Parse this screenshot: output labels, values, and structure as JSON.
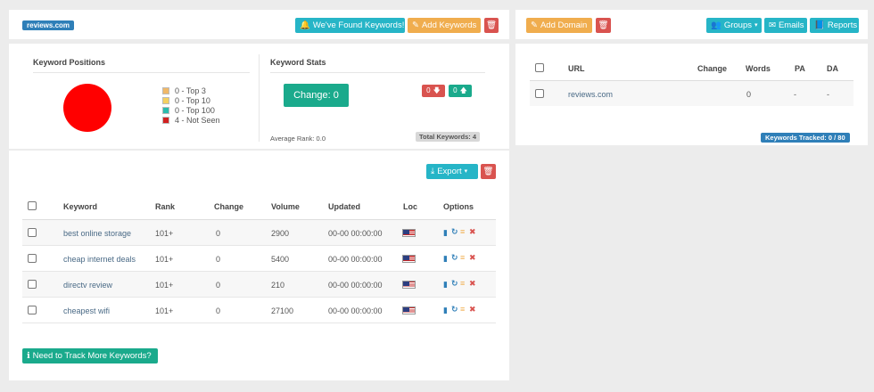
{
  "colors": {
    "teal": "#26b5c7",
    "orange": "#f0ad4e",
    "red": "#d9534f",
    "green": "#1aaa8c",
    "badge_blue": "#2f7fb8",
    "pie_red": "#ff0000"
  },
  "domain_badge": "reviews.com",
  "toolbar": {
    "found_keywords_label": "We've Found Keywords!",
    "found_keywords_icon": "bell-icon",
    "add_keywords_label": "Add Keywords",
    "add_keywords_icon": "edit-icon",
    "delete_icon": "trash-icon"
  },
  "keyword_positions": {
    "title": "Keyword Positions",
    "legend": [
      {
        "label": "0 - Top 3",
        "color": "#f0b868"
      },
      {
        "label": "0 - Top 10",
        "color": "#f5d060"
      },
      {
        "label": "0 - Top 100",
        "color": "#2bbbad"
      },
      {
        "label": "4 - Not Seen",
        "color": "#d12020"
      }
    ]
  },
  "keyword_stats": {
    "title": "Keyword Stats",
    "change_label": "Change: 0",
    "down_count": "0",
    "up_count": "0",
    "average_rank": "Average Rank: 0.0",
    "total_keywords": "Total Keywords: 4"
  },
  "keywords_table": {
    "export_label": "Export",
    "columns": [
      "Keyword",
      "Rank",
      "Change",
      "Volume",
      "Updated",
      "Loc",
      "Options"
    ],
    "rows": [
      {
        "keyword": "best online storage",
        "rank": "101+",
        "change": "0",
        "volume": "2900",
        "updated": "00-00 00:00:00"
      },
      {
        "keyword": "cheap internet deals",
        "rank": "101+",
        "change": "0",
        "volume": "5400",
        "updated": "00-00 00:00:00"
      },
      {
        "keyword": "directv review",
        "rank": "101+",
        "change": "0",
        "volume": "210",
        "updated": "00-00 00:00:00"
      },
      {
        "keyword": "cheapest wifi",
        "rank": "101+",
        "change": "0",
        "volume": "27100",
        "updated": "00-00 00:00:00"
      }
    ],
    "track_more_label": "Need to Track More Keywords?"
  },
  "domains": {
    "add_domain_label": "Add Domain",
    "groups_label": "Groups",
    "emails_label": "Emails",
    "reports_label": "Reports",
    "columns": [
      "URL",
      "Change",
      "Words",
      "PA",
      "DA"
    ],
    "rows": [
      {
        "url": "reviews.com",
        "change": "",
        "words": "0",
        "pa": "-",
        "da": "-"
      }
    ],
    "tracked_label": "Keywords Tracked: 0 / 80"
  }
}
